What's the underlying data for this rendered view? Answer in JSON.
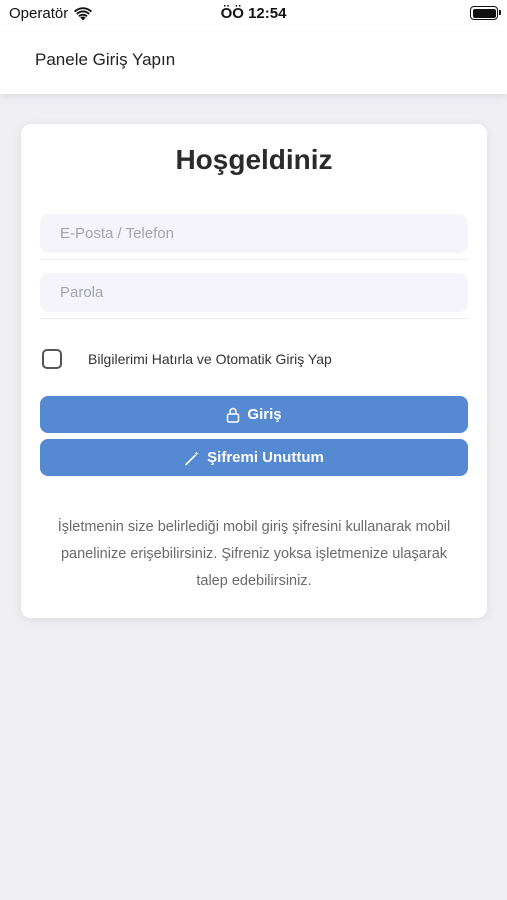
{
  "status_bar": {
    "carrier": "Operatör",
    "time": "ÖÖ 12:54",
    "icons": [
      "wifi-icon",
      "battery-icon"
    ]
  },
  "nav": {
    "title": "Panele Giriş Yapın"
  },
  "login": {
    "heading": "Hoşgeldiniz",
    "email_placeholder": "E-Posta / Telefon",
    "email_value": "",
    "password_placeholder": "Parola",
    "password_value": "",
    "remember_label": "Bilgilerimi Hatırla ve Otomatik Giriş Yap",
    "remember_checked": false,
    "login_button": "Giriş",
    "login_icon": "lock-icon",
    "forgot_button": "Şifremi Unuttum",
    "forgot_icon": "magic-wand-icon",
    "info_text": "İşletmenin size belirlediği mobil giriş şifresini kullanarak mobil panelinize erişebilirsiniz. Şifreniz yoksa işletmenize ulaşarak talep edebilirsiniz."
  },
  "colors": {
    "background": "#efeff4",
    "card": "#ffffff",
    "input_background": "#f4f4fa",
    "button": "#5589d1",
    "button_text": "#ffffff",
    "info_text": "#6b6b6b"
  }
}
